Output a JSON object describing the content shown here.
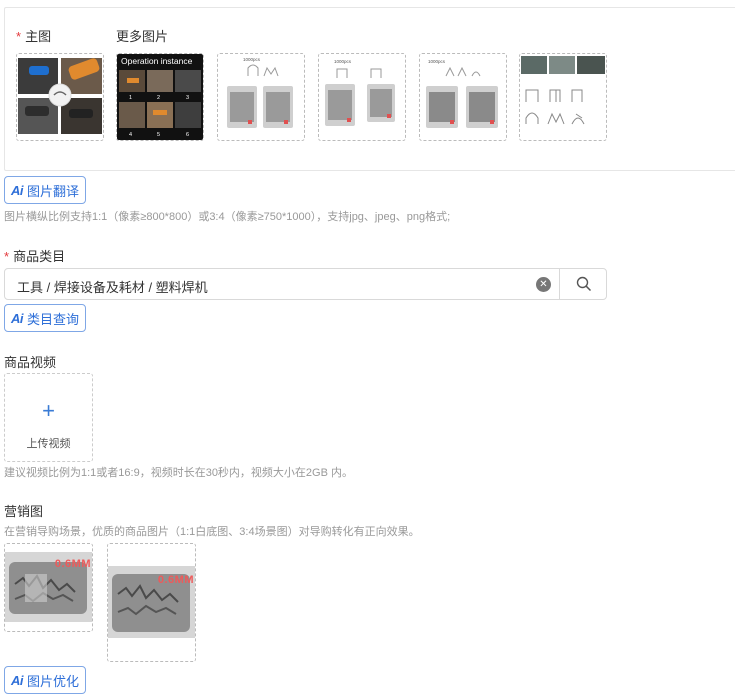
{
  "main_image": {
    "required_mark": "*",
    "label": "主图"
  },
  "more_images": {
    "label": "更多图片"
  },
  "thumbs": {
    "t2_caption": "Operation instance",
    "t2_numbers": [
      "1",
      "2",
      "3",
      "4",
      "5",
      "6"
    ],
    "t3_caption": "1000pcs",
    "t4_caption": "1000pcs",
    "t5_caption": "1000pcs"
  },
  "image_translate_button": {
    "ai": "Ai",
    "label": "图片翻译"
  },
  "image_hint": "图片横纵比例支持1:1（像素≥800*800）或3:4（像素≥750*1000），支持jpg、jpeg、png格式;",
  "category": {
    "required_mark": "*",
    "label": "商品类目",
    "value": "工具 / 焊接设备及耗材 / 塑料焊机",
    "query_button_ai": "Ai",
    "query_button_label": "类目查询"
  },
  "video": {
    "label": "商品视频",
    "upload_plus": "+",
    "upload_label": "上传视频",
    "hint": "建议视频比例为1:1或者16:9，视频时长在30秒内，视频大小在2GB 内。"
  },
  "marketing": {
    "label": "营销图",
    "hint": "在营销导购场景，优质的商品图片（1:1白底图、3:4场景图）对导购转化有正向效果。",
    "img1_tag": "0.6MM",
    "img2_tag": "0.6MM"
  },
  "image_optimize_button": {
    "ai": "Ai",
    "label": "图片优化"
  },
  "colors": {
    "accent": "#2e6fd8",
    "required": "#e4393c",
    "hint": "#999999"
  }
}
